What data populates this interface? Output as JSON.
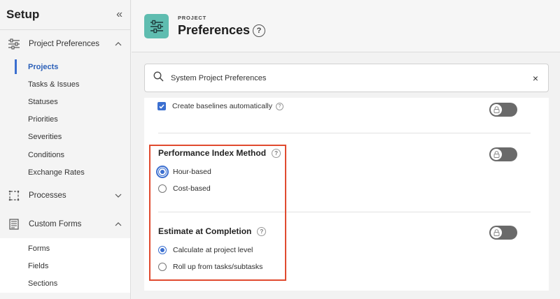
{
  "sidebar": {
    "title": "Setup",
    "collapse_glyph": "«",
    "sections": [
      {
        "label": "Project Preferences",
        "icon": "sliders-icon",
        "expanded": true
      },
      {
        "label": "Processes",
        "icon": "process-icon",
        "expanded": false
      },
      {
        "label": "Custom Forms",
        "icon": "form-icon",
        "expanded": true
      }
    ],
    "project_items": [
      "Projects",
      "Tasks & Issues",
      "Statuses",
      "Priorities",
      "Severities",
      "Conditions",
      "Exchange Rates"
    ],
    "form_items": [
      "Forms",
      "Fields",
      "Sections"
    ],
    "active_item": "Projects"
  },
  "header": {
    "eyebrow": "PROJECT",
    "title": "Preferences",
    "help": "?"
  },
  "search": {
    "value": "System Project Preferences",
    "clear": "×"
  },
  "card": {
    "partial_row": {
      "label": "Create baselines automatically",
      "checked": true
    },
    "performance": {
      "title": "Performance Index Method",
      "options": [
        "Hour-based",
        "Cost-based"
      ],
      "selected": "Hour-based",
      "locked": true
    },
    "estimate": {
      "title": "Estimate at Completion",
      "options": [
        "Calculate at project level",
        "Roll up from tasks/subtasks"
      ],
      "selected": "Calculate at project level",
      "locked": true
    }
  },
  "colors": {
    "accent": "#3b6fd0",
    "header_icon_bg": "#5fbdb0",
    "highlight_border": "#e04a2f",
    "toggle_bg": "#6a6a6a"
  }
}
